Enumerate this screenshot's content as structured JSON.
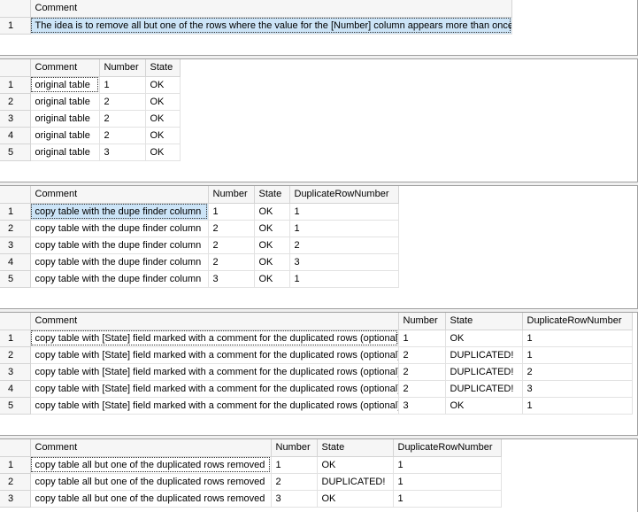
{
  "grids": [
    {
      "columns": [
        "Comment"
      ],
      "rows": [
        {
          "n": "1",
          "cells": [
            "The idea is to remove all but one of the rows where the value for the [Number] column appears more than once."
          ]
        }
      ]
    },
    {
      "columns": [
        "Comment",
        "Number",
        "State"
      ],
      "rows": [
        {
          "n": "1",
          "cells": [
            "original table",
            "1",
            "OK"
          ]
        },
        {
          "n": "2",
          "cells": [
            "original table",
            "2",
            "OK"
          ]
        },
        {
          "n": "3",
          "cells": [
            "original table",
            "2",
            "OK"
          ]
        },
        {
          "n": "4",
          "cells": [
            "original table",
            "2",
            "OK"
          ]
        },
        {
          "n": "5",
          "cells": [
            "original table",
            "3",
            "OK"
          ]
        }
      ]
    },
    {
      "columns": [
        "Comment",
        "Number",
        "State",
        "DuplicateRowNumber"
      ],
      "rows": [
        {
          "n": "1",
          "cells": [
            "copy table with the dupe finder column",
            "1",
            "OK",
            "1"
          ]
        },
        {
          "n": "2",
          "cells": [
            "copy table with the dupe finder column",
            "2",
            "OK",
            "1"
          ]
        },
        {
          "n": "3",
          "cells": [
            "copy table with the dupe finder column",
            "2",
            "OK",
            "2"
          ]
        },
        {
          "n": "4",
          "cells": [
            "copy table with the dupe finder column",
            "2",
            "OK",
            "3"
          ]
        },
        {
          "n": "5",
          "cells": [
            "copy table with the dupe finder column",
            "3",
            "OK",
            "1"
          ]
        }
      ]
    },
    {
      "columns": [
        "Comment",
        "Number",
        "State",
        "DuplicateRowNumber"
      ],
      "rows": [
        {
          "n": "1",
          "cells": [
            "copy table with [State] field marked with a comment for the duplicated rows (optional)",
            "1",
            "OK",
            "1"
          ]
        },
        {
          "n": "2",
          "cells": [
            "copy table with [State] field marked with a comment for the duplicated rows (optional)",
            "2",
            "DUPLICATED!",
            "1"
          ]
        },
        {
          "n": "3",
          "cells": [
            "copy table with [State] field marked with a comment for the duplicated rows (optional)",
            "2",
            "DUPLICATED!",
            "2"
          ]
        },
        {
          "n": "4",
          "cells": [
            "copy table with [State] field marked with a comment for the duplicated rows (optional)",
            "2",
            "DUPLICATED!",
            "3"
          ]
        },
        {
          "n": "5",
          "cells": [
            "copy table with [State] field marked with a comment for the duplicated rows (optional)",
            "3",
            "OK",
            "1"
          ]
        }
      ]
    },
    {
      "columns": [
        "Comment",
        "Number",
        "State",
        "DuplicateRowNumber"
      ],
      "rows": [
        {
          "n": "1",
          "cells": [
            "copy table all but one of the duplicated rows removed",
            "1",
            "OK",
            "1"
          ]
        },
        {
          "n": "2",
          "cells": [
            "copy table all but one of the duplicated rows removed",
            "2",
            "DUPLICATED!",
            "1"
          ]
        },
        {
          "n": "3",
          "cells": [
            "copy table all but one of the duplicated rows removed",
            "3",
            "OK",
            "1"
          ]
        }
      ]
    }
  ],
  "colors": {
    "header_bg": "#f6f6f6",
    "selected_cell_bg": "#cce4f7",
    "separator_bg": "#f0f0f0"
  }
}
